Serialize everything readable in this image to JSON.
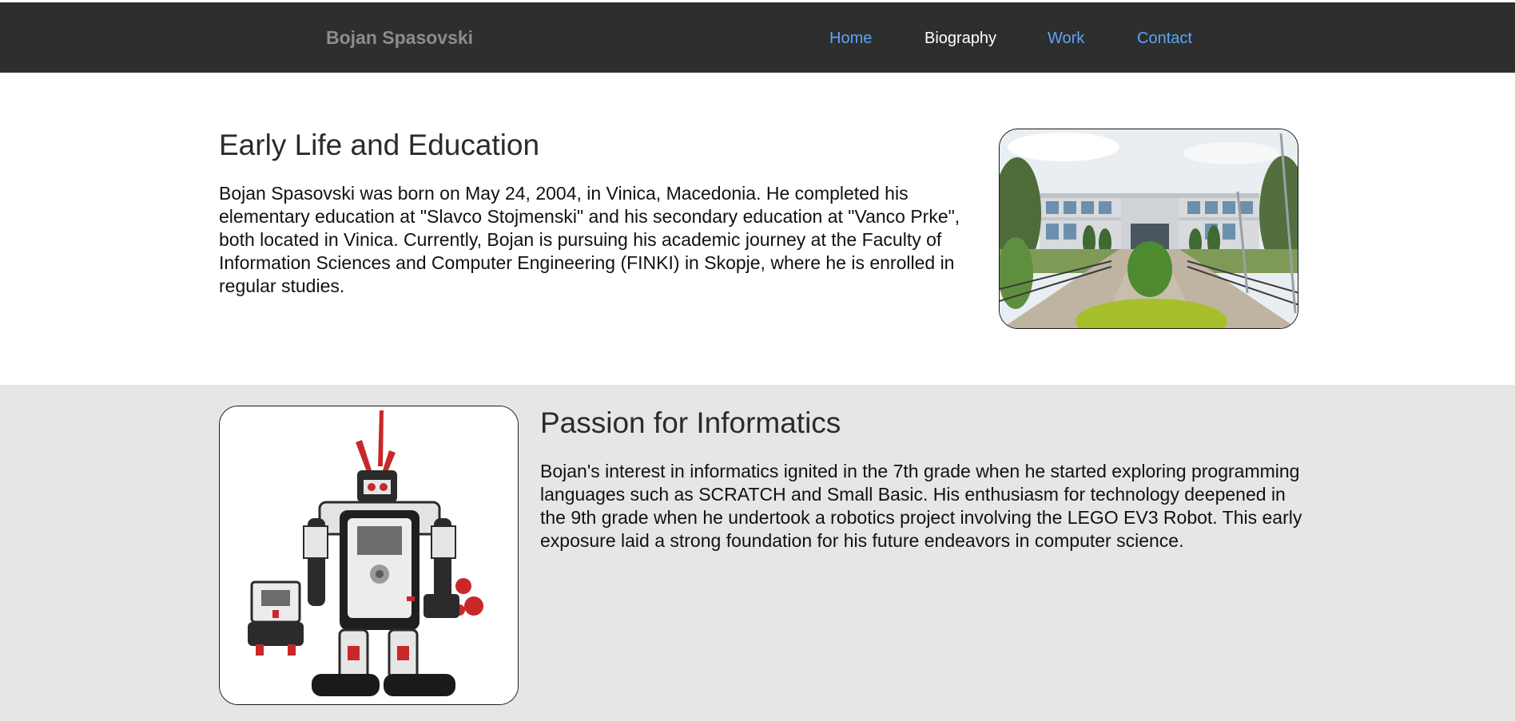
{
  "header": {
    "brand": "Bojan Spasovski",
    "nav": [
      {
        "label": "Home",
        "active": false
      },
      {
        "label": "Biography",
        "active": true
      },
      {
        "label": "Work",
        "active": false
      },
      {
        "label": "Contact",
        "active": false
      }
    ]
  },
  "sections": {
    "education": {
      "title": "Early Life and Education",
      "body": "Bojan Spasovski was born on May 24, 2004, in Vinica, Macedonia. He completed his elementary education at \"Slavco Stojmenski\" and his secondary education at \"Vanco Prke\", both located in Vinica. Currently, Bojan is pursuing his academic journey at the Faculty of Information Sciences and Computer Engineering (FINKI) in Skopje, where he is enrolled in regular studies.",
      "image": "school-building-photo"
    },
    "informatics": {
      "title": "Passion for Informatics",
      "body": "Bojan's interest in informatics ignited in the 7th grade when he started exploring programming languages such as SCRATCH and Small Basic. His enthusiasm for technology deepened in the 9th grade when he undertook a robotics project involving the LEGO EV3 Robot. This early exposure laid a strong foundation for his future endeavors in computer science.",
      "image": "lego-ev3-robot-photo"
    }
  },
  "colors": {
    "navbar_bg": "#2e2e2e",
    "brand": "#8c8c8c",
    "link": "#5aa6f5",
    "link_active": "#ffffff",
    "section_alt_bg": "#e6e6e6"
  }
}
